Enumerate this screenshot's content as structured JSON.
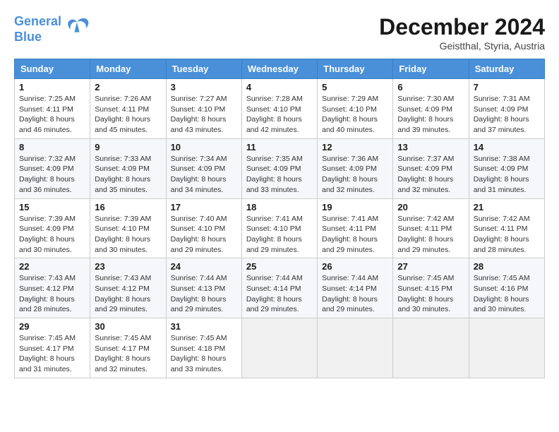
{
  "header": {
    "logo_line1": "General",
    "logo_line2": "Blue",
    "month_title": "December 2024",
    "location": "Geistthal, Styria, Austria"
  },
  "days_of_week": [
    "Sunday",
    "Monday",
    "Tuesday",
    "Wednesday",
    "Thursday",
    "Friday",
    "Saturday"
  ],
  "weeks": [
    [
      {
        "day": "1",
        "info": "Sunrise: 7:25 AM\nSunset: 4:11 PM\nDaylight: 8 hours\nand 46 minutes."
      },
      {
        "day": "2",
        "info": "Sunrise: 7:26 AM\nSunset: 4:11 PM\nDaylight: 8 hours\nand 45 minutes."
      },
      {
        "day": "3",
        "info": "Sunrise: 7:27 AM\nSunset: 4:10 PM\nDaylight: 8 hours\nand 43 minutes."
      },
      {
        "day": "4",
        "info": "Sunrise: 7:28 AM\nSunset: 4:10 PM\nDaylight: 8 hours\nand 42 minutes."
      },
      {
        "day": "5",
        "info": "Sunrise: 7:29 AM\nSunset: 4:10 PM\nDaylight: 8 hours\nand 40 minutes."
      },
      {
        "day": "6",
        "info": "Sunrise: 7:30 AM\nSunset: 4:09 PM\nDaylight: 8 hours\nand 39 minutes."
      },
      {
        "day": "7",
        "info": "Sunrise: 7:31 AM\nSunset: 4:09 PM\nDaylight: 8 hours\nand 37 minutes."
      }
    ],
    [
      {
        "day": "8",
        "info": "Sunrise: 7:32 AM\nSunset: 4:09 PM\nDaylight: 8 hours\nand 36 minutes."
      },
      {
        "day": "9",
        "info": "Sunrise: 7:33 AM\nSunset: 4:09 PM\nDaylight: 8 hours\nand 35 minutes."
      },
      {
        "day": "10",
        "info": "Sunrise: 7:34 AM\nSunset: 4:09 PM\nDaylight: 8 hours\nand 34 minutes."
      },
      {
        "day": "11",
        "info": "Sunrise: 7:35 AM\nSunset: 4:09 PM\nDaylight: 8 hours\nand 33 minutes."
      },
      {
        "day": "12",
        "info": "Sunrise: 7:36 AM\nSunset: 4:09 PM\nDaylight: 8 hours\nand 32 minutes."
      },
      {
        "day": "13",
        "info": "Sunrise: 7:37 AM\nSunset: 4:09 PM\nDaylight: 8 hours\nand 32 minutes."
      },
      {
        "day": "14",
        "info": "Sunrise: 7:38 AM\nSunset: 4:09 PM\nDaylight: 8 hours\nand 31 minutes."
      }
    ],
    [
      {
        "day": "15",
        "info": "Sunrise: 7:39 AM\nSunset: 4:09 PM\nDaylight: 8 hours\nand 30 minutes."
      },
      {
        "day": "16",
        "info": "Sunrise: 7:39 AM\nSunset: 4:10 PM\nDaylight: 8 hours\nand 30 minutes."
      },
      {
        "day": "17",
        "info": "Sunrise: 7:40 AM\nSunset: 4:10 PM\nDaylight: 8 hours\nand 29 minutes."
      },
      {
        "day": "18",
        "info": "Sunrise: 7:41 AM\nSunset: 4:10 PM\nDaylight: 8 hours\nand 29 minutes."
      },
      {
        "day": "19",
        "info": "Sunrise: 7:41 AM\nSunset: 4:11 PM\nDaylight: 8 hours\nand 29 minutes."
      },
      {
        "day": "20",
        "info": "Sunrise: 7:42 AM\nSunset: 4:11 PM\nDaylight: 8 hours\nand 29 minutes."
      },
      {
        "day": "21",
        "info": "Sunrise: 7:42 AM\nSunset: 4:11 PM\nDaylight: 8 hours\nand 28 minutes."
      }
    ],
    [
      {
        "day": "22",
        "info": "Sunrise: 7:43 AM\nSunset: 4:12 PM\nDaylight: 8 hours\nand 28 minutes."
      },
      {
        "day": "23",
        "info": "Sunrise: 7:43 AM\nSunset: 4:12 PM\nDaylight: 8 hours\nand 29 minutes."
      },
      {
        "day": "24",
        "info": "Sunrise: 7:44 AM\nSunset: 4:13 PM\nDaylight: 8 hours\nand 29 minutes."
      },
      {
        "day": "25",
        "info": "Sunrise: 7:44 AM\nSunset: 4:14 PM\nDaylight: 8 hours\nand 29 minutes."
      },
      {
        "day": "26",
        "info": "Sunrise: 7:44 AM\nSunset: 4:14 PM\nDaylight: 8 hours\nand 29 minutes."
      },
      {
        "day": "27",
        "info": "Sunrise: 7:45 AM\nSunset: 4:15 PM\nDaylight: 8 hours\nand 30 minutes."
      },
      {
        "day": "28",
        "info": "Sunrise: 7:45 AM\nSunset: 4:16 PM\nDaylight: 8 hours\nand 30 minutes."
      }
    ],
    [
      {
        "day": "29",
        "info": "Sunrise: 7:45 AM\nSunset: 4:17 PM\nDaylight: 8 hours\nand 31 minutes."
      },
      {
        "day": "30",
        "info": "Sunrise: 7:45 AM\nSunset: 4:17 PM\nDaylight: 8 hours\nand 32 minutes."
      },
      {
        "day": "31",
        "info": "Sunrise: 7:45 AM\nSunset: 4:18 PM\nDaylight: 8 hours\nand 33 minutes."
      },
      {
        "day": "",
        "info": ""
      },
      {
        "day": "",
        "info": ""
      },
      {
        "day": "",
        "info": ""
      },
      {
        "day": "",
        "info": ""
      }
    ]
  ]
}
